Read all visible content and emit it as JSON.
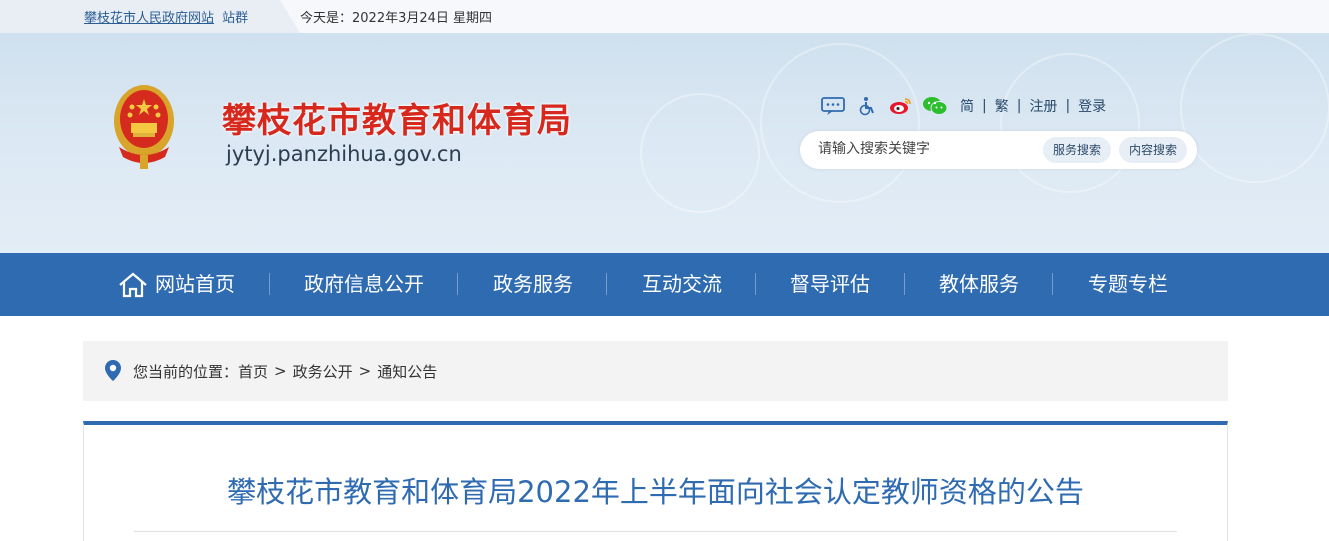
{
  "topbar": {
    "site_link": "攀枝花市人民政府网站",
    "site_group": "站群",
    "date_text": "今天是：2022年3月24日 星期四"
  },
  "header": {
    "title": "攀枝花市教育和体育局",
    "domain": "jytyj.panzhihua.gov.cn",
    "tools": {
      "icons": [
        "accessible-dialog-icon",
        "wheelchair-icon",
        "weibo-icon",
        "wechat-icon"
      ],
      "simplified": "简",
      "traditional": "繁",
      "register": "注册",
      "login": "登录",
      "sep": "|"
    },
    "search": {
      "placeholder": "请输入搜索关键字",
      "service_button": "服务搜索",
      "content_button": "内容搜索"
    }
  },
  "nav": {
    "items": [
      {
        "label": "网站首页",
        "icon": "home-icon"
      },
      {
        "label": "政府信息公开"
      },
      {
        "label": "政务服务"
      },
      {
        "label": "互动交流"
      },
      {
        "label": "督导评估"
      },
      {
        "label": "教体服务"
      },
      {
        "label": "专题专栏"
      }
    ]
  },
  "breadcrumb": {
    "prefix": "您当前的位置：",
    "items": [
      "首页",
      "政务公开",
      "通知公告"
    ],
    "sep": ">"
  },
  "article": {
    "title": "攀枝花市教育和体育局2022年上半年面向社会认定教师资格的公告"
  },
  "colors": {
    "nav_bg": "#2f6bb0",
    "title_red": "#d6281c",
    "link_blue": "#2a5d95"
  }
}
